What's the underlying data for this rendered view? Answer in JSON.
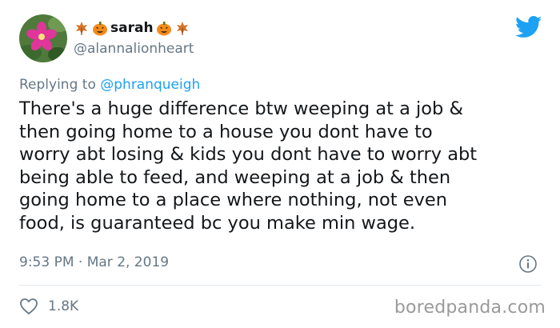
{
  "user": {
    "display_name": "sarah",
    "handle": "@alannalionheart",
    "avatar_icon": "pink-flower-avatar",
    "name_decorations": [
      "maple-leaf-icon",
      "pumpkin-icon",
      "pumpkin-icon",
      "maple-leaf-icon"
    ]
  },
  "reply": {
    "prefix": "Replying to",
    "mention": "@phranqueigh"
  },
  "tweet": {
    "lines": [
      "There's a huge difference btw weeping at a job &",
      "then going home to a house you dont have to",
      "worry abt losing & kids you dont have to worry abt",
      "being able to feed, and weeping at a job & then",
      "going home to a place where nothing, not even",
      "food, is guaranteed bc you make min wage."
    ],
    "timestamp": "9:53 PM · Mar 2, 2019",
    "likes": "1.8K"
  },
  "watermark": "boredpanda.com",
  "colors": {
    "text": "#14171a",
    "muted": "#657786",
    "twitter_blue": "#1da1f2",
    "divider": "#e1e8ed"
  }
}
